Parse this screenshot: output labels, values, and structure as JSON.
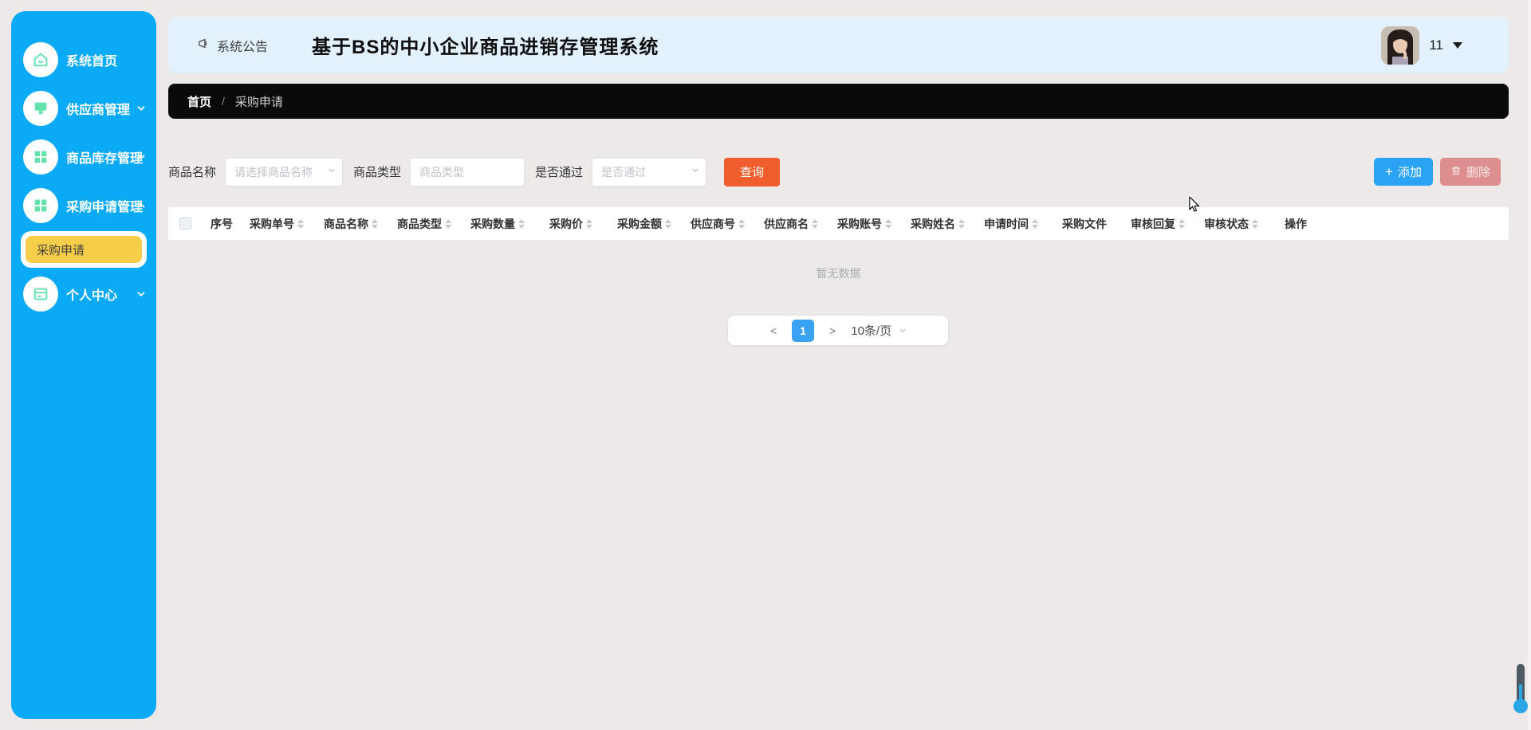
{
  "app": {
    "title": "基于BS的中小企业商品进销存管理系统",
    "notice_label": "系统公告",
    "user_badge": "11"
  },
  "sidebar": {
    "items": [
      {
        "label": "系统首页",
        "icon": "home-icon",
        "chevron": "none"
      },
      {
        "label": "供应商管理",
        "icon": "supplier-icon",
        "chevron": "down"
      },
      {
        "label": "商品库存管理",
        "icon": "grid-icon",
        "chevron": "down"
      },
      {
        "label": "采购申请管理",
        "icon": "grid-icon",
        "chevron": "up"
      },
      {
        "label": "个人中心",
        "icon": "card-icon",
        "chevron": "down"
      }
    ],
    "submenu": {
      "label": "采购申请",
      "active": true
    }
  },
  "breadcrumb": {
    "home": "首页",
    "separator": "/",
    "current": "采购申请"
  },
  "filters": {
    "name_label": "商品名称",
    "name_placeholder": "请选择商品名称",
    "type_label": "商品类型",
    "type_placeholder": "商品类型",
    "pass_label": "是否通过",
    "pass_placeholder": "是否通过",
    "search_button": "查询"
  },
  "actions": {
    "add_button": "添加",
    "delete_button": "删除"
  },
  "table": {
    "empty_text": "暂无数据",
    "columns": [
      {
        "label": "序号",
        "sortable": false
      },
      {
        "label": "采购单号",
        "sortable": true
      },
      {
        "label": "商品名称",
        "sortable": true
      },
      {
        "label": "商品类型",
        "sortable": true
      },
      {
        "label": "采购数量",
        "sortable": true
      },
      {
        "label": "采购价",
        "sortable": true
      },
      {
        "label": "采购金额",
        "sortable": true
      },
      {
        "label": "供应商号",
        "sortable": true
      },
      {
        "label": "供应商名",
        "sortable": true
      },
      {
        "label": "采购账号",
        "sortable": true
      },
      {
        "label": "采购姓名",
        "sortable": true
      },
      {
        "label": "申请时间",
        "sortable": true
      },
      {
        "label": "采购文件",
        "sortable": false
      },
      {
        "label": "审核回复",
        "sortable": true
      },
      {
        "label": "审核状态",
        "sortable": true
      },
      {
        "label": "操作",
        "sortable": false
      }
    ]
  },
  "pagination": {
    "prev": "<",
    "current_page": "1",
    "next": ">",
    "page_size": "10条/页"
  },
  "colors": {
    "sidebar_blue": "#0aaaf6",
    "icon_green": "#63e2ab",
    "active_yellow": "#f6ce4a",
    "header_bg": "#e3f1fc",
    "breadcrumb_bg": "#0a0a0a",
    "search_orange": "#f05e2e",
    "add_blue": "#2aa3f4",
    "delete_pink": "#dd8e8e",
    "page_active_blue": "#3aa2f3"
  }
}
